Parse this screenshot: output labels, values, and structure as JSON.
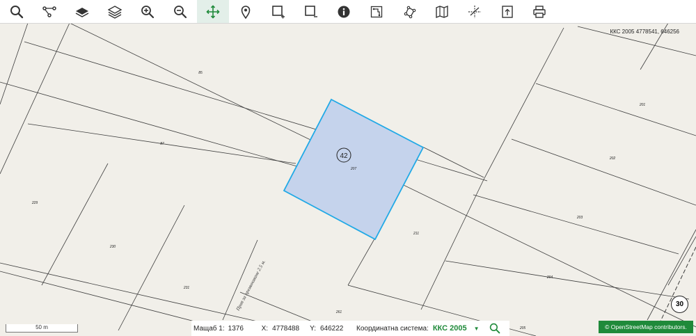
{
  "toolbar": {
    "tools": [
      {
        "name": "search-icon",
        "active": false
      },
      {
        "name": "route-icon",
        "active": false
      },
      {
        "name": "layer-icon",
        "active": false
      },
      {
        "name": "layers-icon",
        "active": false
      },
      {
        "name": "zoom-in-icon",
        "active": false
      },
      {
        "name": "zoom-out-icon",
        "active": false
      },
      {
        "name": "pan-icon",
        "active": true
      },
      {
        "name": "marker-icon",
        "active": false
      },
      {
        "name": "select-rect-add-icon",
        "active": false
      },
      {
        "name": "select-rect-remove-icon",
        "active": false
      },
      {
        "name": "info-icon",
        "active": false
      },
      {
        "name": "measure-distance-icon",
        "active": false
      },
      {
        "name": "measure-area-icon",
        "active": false
      },
      {
        "name": "map-icon",
        "active": false
      },
      {
        "name": "crosshair-icon",
        "active": false
      },
      {
        "name": "export-icon",
        "active": false
      },
      {
        "name": "print-icon",
        "active": false
      }
    ]
  },
  "coordinates_readout": "ККС 2005 4778541, 646256",
  "map": {
    "selected_parcel": {
      "label": "42",
      "number": "207"
    },
    "parcel_labels": [
      "85",
      "87",
      "229",
      "230",
      "231",
      "261",
      "211",
      "201",
      "202",
      "203",
      "204",
      "205"
    ],
    "road_label": "Прав за преминаване 2.5 м.",
    "road_badge": "30",
    "colors": {
      "selection_fill": "#c5d3ec",
      "selection_stroke": "#21a9e6",
      "background": "#f1efe9",
      "lines": "#3c3c3c"
    }
  },
  "statusbar": {
    "scale_label": "Мащаб 1:",
    "scale_value": "1376",
    "x_label": "X:",
    "x_value": "4778488",
    "y_label": "Y:",
    "y_value": "646222",
    "crs_label": "Координатна система:",
    "crs_value": "ККС 2005"
  },
  "scalebar_label": "50 m",
  "attribution": "© OpenStreetMap contributors."
}
